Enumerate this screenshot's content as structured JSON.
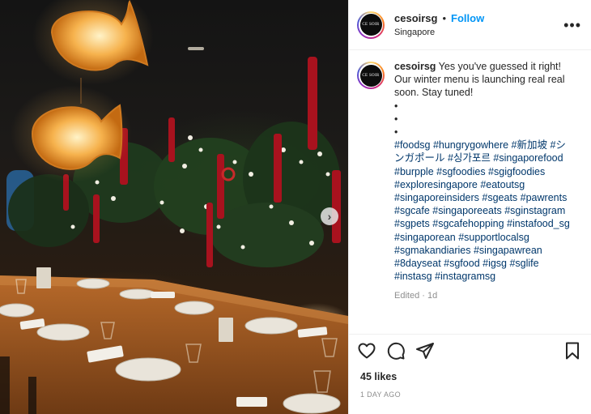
{
  "post": {
    "username": "cesoirsg",
    "separator": "•",
    "follow_label": "Follow",
    "location": "Singapore",
    "more_label": "•••",
    "avatar_text": "CE SOIR",
    "caption_user": "cesoirsg",
    "caption_text": "Yes you've guessed it right! Our winter menu is launching real real soon. Stay tuned!",
    "bullets": [
      "•",
      "•",
      "•"
    ],
    "hashtags": "#foodsg #hungrygowhere #新加坡 #シンガポール #싱가포르 #singaporefood #burpple #sgfoodies #sgigfoodies #exploresingapore #eatoutsg #singaporeinsiders #sgeats #pawrents #sgcafe #singaporeeats #sginstagram #sgpets #sgcafehopping #instafood_sg #singaporean #supportlocalsg #sgmakandiaries #singapawrean #8dayseat #sgfood #igsg #sglife #instasg #instagramsg",
    "edited": "Edited · 1d",
    "likes": "45 likes",
    "date": "1 DAY AGO",
    "next_arrow": "›"
  },
  "icons": {
    "like": "heart-icon",
    "comment": "comment-icon",
    "share": "share-icon",
    "save": "bookmark-icon",
    "next": "chevron-right-icon"
  },
  "colors": {
    "follow": "#0095f6",
    "hashtag": "#00376b",
    "muted": "#8e8e8e",
    "text": "#262626"
  }
}
